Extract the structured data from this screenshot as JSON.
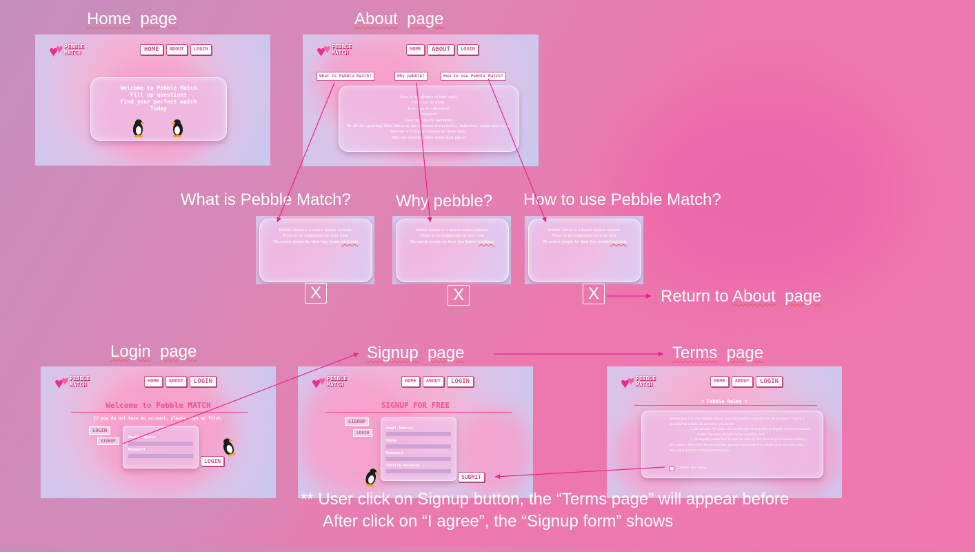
{
  "titles": {
    "home": [
      "Home",
      "page"
    ],
    "about": [
      "About",
      "page"
    ],
    "what": "What is Pebble Match?",
    "why": "Why pebble?",
    "how": "How to use Pebble Match?",
    "return_label": "Return to",
    "return_link": [
      "About",
      "page"
    ],
    "login": [
      "Login",
      "page"
    ],
    "signup": [
      "Signup",
      "page"
    ],
    "terms": [
      "Terms",
      "page"
    ]
  },
  "logo": [
    "PEBBLE",
    "MATCH"
  ],
  "nav": {
    "home": "HOME",
    "about": "ABOUT",
    "login": "LOGIN"
  },
  "home_screen": {
    "lines": [
      "Welcome to Pebble Match",
      "Fill up questions",
      "Find your perfect match",
      "Today"
    ]
  },
  "about_screen": {
    "tabs": [
      "What is Pebble Match?",
      "Why pebble?",
      "How to use Pebble Match?"
    ],
    "lines": [
      "Love is not always at first sight.",
      "Love can be blind.",
      "Love can be cultivated.",
      "However,",
      "Love can also be damaged.",
      "By all the upsetting little things as our different living habits, behaviors, values and so on.",
      "Instead of trying to change all these gaps,",
      "Why not avoiding them in the first place?"
    ]
  },
  "popup": {
    "lines": [
      "Pebble Match is a match maker website.",
      "There is no judgement on your look.",
      "We match people by their tiny habits"
    ],
    "extra": "blablabla",
    "close": "X"
  },
  "login_screen": {
    "heading": "Welcome to Pebble MATCH",
    "sub": "If you do not have an account, please sign up first.",
    "tab_login": "LOGIN",
    "tab_signup": "SIGNUP",
    "email": "Email Address",
    "password": "Password",
    "button": "LOGIN"
  },
  "signup_screen": {
    "heading": "SIGNUP FOR FREE",
    "tab_signup": "SIGNUP",
    "tab_login": "LOGIN",
    "email": "Email Address",
    "phone": "Phone",
    "password": "Password",
    "confirm": "Confirm Password",
    "button": "SUBMIT"
  },
  "terms_screen": {
    "heading": "< Pebble Rules >",
    "lines": [
      "Before you can use Pebble Match, you will need to register for an account (\"Login\").",
      "In order to create an account, you must:",
      "1. be at least 18 years old or the age of majority to legally enter a contract",
      "under the laws of your home country; and",
      "2. be legally permitted to use the site by the laws of your home country.",
      "We cannot allow you to use another person's account or to share your account with",
      "any other person without permission."
    ],
    "agree": "I agree the rules"
  },
  "note": {
    "line1": "** User click on Signup button, the “Terms page” will appear before",
    "line2": "After click on “I agree”, the “Signup form” shows"
  },
  "colors": {
    "arrow": "#e8238a",
    "accent": "#d0538f"
  }
}
